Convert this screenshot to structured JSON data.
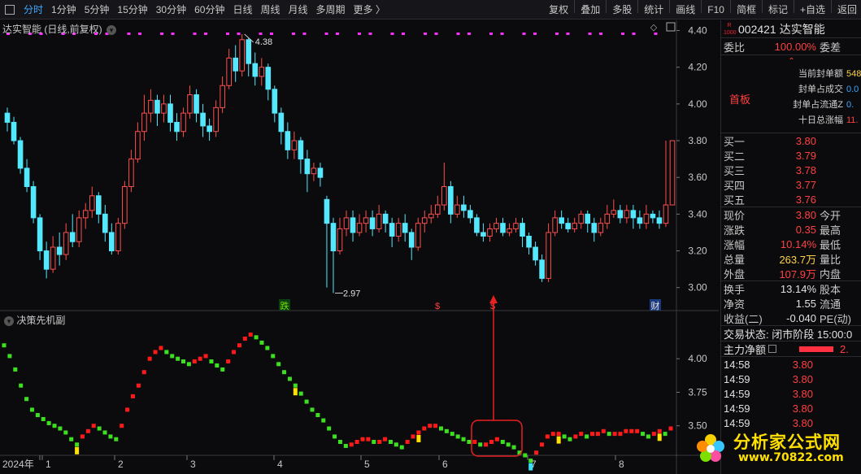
{
  "toolbar": {
    "items": [
      "分时",
      "1分钟",
      "5分钟",
      "15分钟",
      "30分钟",
      "60分钟",
      "日线",
      "周线",
      "月线",
      "多周期",
      "更多 〉"
    ],
    "right_items": [
      "复权",
      "叠加",
      "多股",
      "统计",
      "画线",
      "F10",
      "简框",
      "标记",
      "+自选",
      "返回"
    ]
  },
  "main_chart": {
    "title": "达实智能 (日线,前复权)",
    "y_ticks": [
      "4.40",
      "4.20",
      "4.00",
      "3.80",
      "3.60",
      "3.40",
      "3.20",
      "3.00"
    ],
    "high_label": "4.38",
    "low_label": "2.97",
    "markers": [
      "跌",
      "$",
      "$",
      "财"
    ]
  },
  "sub_chart": {
    "title": "决策先机副",
    "y_ticks": [
      "4.00",
      "3.75",
      "3.50"
    ]
  },
  "x_axis": {
    "labels": [
      "2024年",
      "1",
      "2",
      "3",
      "4",
      "5",
      "6",
      "7",
      "8"
    ]
  },
  "quote": {
    "code": "002421",
    "name": "达实智能",
    "badge_top": "R",
    "badge_bottom": "1000",
    "weibi_label": "委比",
    "weibi_value": "100.00%",
    "weicha_label": "委差",
    "seal": {
      "lines": [
        "当前封单额",
        "封单占成交",
        "封单占流通Z",
        "十日总涨幅"
      ],
      "values": [
        "548",
        "0.0",
        "0.",
        "11."
      ],
      "tag": "首板"
    },
    "bids": [
      {
        "label": "买一",
        "price": "3.80"
      },
      {
        "label": "买二",
        "price": "3.79"
      },
      {
        "label": "买三",
        "price": "3.78"
      },
      {
        "label": "买四",
        "price": "3.77"
      },
      {
        "label": "买五",
        "price": "3.76"
      }
    ],
    "stats": [
      {
        "label": "现价",
        "value": "3.80",
        "label2": "今开",
        "cls": "red"
      },
      {
        "label": "涨跌",
        "value": "0.35",
        "label2": "最高",
        "cls": "red"
      },
      {
        "label": "涨幅",
        "value": "10.14%",
        "label2": "最低",
        "cls": "red"
      },
      {
        "label": "总量",
        "value": "263.7万",
        "label2": "量比",
        "cls": "yellow"
      },
      {
        "label": "外盘",
        "value": "107.9万",
        "label2": "内盘",
        "cls": "red"
      }
    ],
    "stats2": [
      {
        "label": "换手",
        "value": "13.14%",
        "label2": "股本",
        "cls": "white"
      },
      {
        "label": "净资",
        "value": "1.55",
        "label2": "流通",
        "cls": "white"
      },
      {
        "label": "收益(二)",
        "value": "-0.040",
        "label2": "PE(动)",
        "cls": "white"
      }
    ],
    "trade_status": "交易状态: 闭市阶段 15:00:0",
    "main_flow_label": "主力净额",
    "main_flow_value": "2.",
    "ticks": [
      {
        "time": "14:58",
        "price": "3.80"
      },
      {
        "time": "14:59",
        "price": "3.80"
      },
      {
        "time": "14:59",
        "price": "3.80"
      },
      {
        "time": "14:59",
        "price": "3.80"
      },
      {
        "time": "14:59",
        "price": "3.80"
      }
    ]
  },
  "watermark": {
    "text": "分析家公式网",
    "url": "www.70822.com"
  },
  "chart_data": {
    "type": "candlestick",
    "title": "达实智能 (日线,前复权)",
    "ylim": [
      2.95,
      4.42
    ],
    "candles": [
      [
        3.95,
        3.9,
        3.98,
        3.85
      ],
      [
        3.9,
        3.8,
        3.93,
        3.78
      ],
      [
        3.8,
        3.65,
        3.82,
        3.62
      ],
      [
        3.65,
        3.55,
        3.7,
        3.52
      ],
      [
        3.55,
        3.38,
        3.58,
        3.35
      ],
      [
        3.38,
        3.2,
        3.4,
        3.15
      ],
      [
        3.2,
        3.1,
        3.25,
        3.05
      ],
      [
        3.1,
        3.22,
        3.28,
        3.08
      ],
      [
        3.22,
        3.18,
        3.3,
        3.12
      ],
      [
        3.18,
        3.3,
        3.35,
        3.15
      ],
      [
        3.3,
        3.25,
        3.4,
        3.22
      ],
      [
        3.25,
        3.38,
        3.42,
        3.22
      ],
      [
        3.38,
        3.42,
        3.46,
        3.32
      ],
      [
        3.42,
        3.5,
        3.55,
        3.38
      ],
      [
        3.5,
        3.4,
        3.52,
        3.35
      ],
      [
        3.4,
        3.3,
        3.45,
        3.25
      ],
      [
        3.3,
        3.2,
        3.35,
        3.18
      ],
      [
        3.2,
        3.35,
        3.38,
        3.18
      ],
      [
        3.35,
        3.55,
        3.58,
        3.32
      ],
      [
        3.55,
        3.7,
        3.75,
        3.52
      ],
      [
        3.7,
        3.85,
        3.9,
        3.68
      ],
      [
        3.85,
        3.95,
        4.05,
        3.8
      ],
      [
        3.95,
        4.02,
        4.08,
        3.9
      ],
      [
        4.02,
        3.95,
        4.05,
        3.88
      ],
      [
        3.95,
        4.0,
        4.05,
        3.9
      ],
      [
        4.0,
        3.9,
        4.05,
        3.85
      ],
      [
        3.9,
        3.85,
        3.95,
        3.8
      ],
      [
        3.85,
        3.95,
        3.98,
        3.82
      ],
      [
        3.95,
        4.05,
        4.1,
        3.92
      ],
      [
        4.05,
        3.95,
        4.08,
        3.9
      ],
      [
        3.95,
        3.88,
        4.0,
        3.82
      ],
      [
        3.88,
        3.85,
        3.92,
        3.8
      ],
      [
        3.85,
        3.98,
        4.02,
        3.82
      ],
      [
        3.98,
        4.1,
        4.15,
        3.95
      ],
      [
        4.1,
        4.25,
        4.3,
        4.08
      ],
      [
        4.25,
        4.18,
        4.32,
        4.12
      ],
      [
        4.18,
        4.35,
        4.38,
        4.15
      ],
      [
        4.35,
        4.22,
        4.36,
        4.15
      ],
      [
        4.22,
        4.15,
        4.28,
        4.1
      ],
      [
        4.15,
        4.2,
        4.25,
        4.1
      ],
      [
        4.2,
        4.08,
        4.22,
        4.02
      ],
      [
        4.08,
        3.95,
        4.1,
        3.9
      ],
      [
        3.95,
        3.85,
        3.98,
        3.78
      ],
      [
        3.85,
        3.75,
        3.9,
        3.7
      ],
      [
        3.75,
        3.8,
        3.85,
        3.7
      ],
      [
        3.8,
        3.7,
        3.82,
        3.62
      ],
      [
        3.7,
        3.62,
        3.75,
        3.52
      ],
      [
        3.62,
        3.65,
        3.68,
        3.58
      ],
      [
        3.65,
        3.6,
        3.68,
        3.55
      ],
      [
        3.48,
        3.35,
        3.5,
        3.0
      ],
      [
        3.35,
        3.2,
        3.38,
        2.97
      ],
      [
        3.2,
        3.32,
        3.38,
        3.18
      ],
      [
        3.32,
        3.38,
        3.42,
        3.28
      ],
      [
        3.38,
        3.3,
        3.42,
        3.25
      ],
      [
        3.3,
        3.35,
        3.4,
        3.28
      ],
      [
        3.35,
        3.38,
        3.42,
        3.3
      ],
      [
        3.38,
        3.32,
        3.42,
        3.28
      ],
      [
        3.32,
        3.4,
        3.45,
        3.3
      ],
      [
        3.4,
        3.35,
        3.42,
        3.3
      ],
      [
        3.35,
        3.28,
        3.38,
        3.22
      ],
      [
        3.28,
        3.35,
        3.38,
        3.25
      ],
      [
        3.35,
        3.3,
        3.4,
        3.25
      ],
      [
        3.3,
        3.22,
        3.32,
        3.15
      ],
      [
        3.22,
        3.35,
        3.38,
        3.2
      ],
      [
        3.35,
        3.38,
        3.42,
        3.3
      ],
      [
        3.38,
        3.4,
        3.45,
        3.35
      ],
      [
        3.4,
        3.45,
        3.5,
        3.38
      ],
      [
        3.45,
        3.55,
        3.68,
        3.42
      ],
      [
        3.55,
        3.4,
        3.58,
        3.35
      ],
      [
        3.4,
        3.45,
        3.5,
        3.38
      ],
      [
        3.45,
        3.42,
        3.5,
        3.38
      ],
      [
        3.42,
        3.38,
        3.45,
        3.35
      ],
      [
        3.38,
        3.3,
        3.4,
        3.28
      ],
      [
        3.3,
        3.28,
        3.35,
        3.25
      ],
      [
        3.28,
        3.32,
        3.35,
        3.25
      ],
      [
        3.32,
        3.35,
        3.38,
        3.3
      ],
      [
        3.35,
        3.3,
        3.38,
        3.28
      ],
      [
        3.3,
        3.32,
        3.35,
        3.28
      ],
      [
        3.32,
        3.35,
        3.38,
        3.3
      ],
      [
        3.35,
        3.28,
        3.38,
        3.22
      ],
      [
        3.28,
        3.22,
        3.3,
        3.18
      ],
      [
        3.22,
        3.15,
        3.25,
        3.12
      ],
      [
        3.15,
        3.05,
        3.18,
        3.03
      ],
      [
        3.05,
        3.3,
        3.35,
        3.03
      ],
      [
        3.3,
        3.38,
        3.42,
        3.28
      ],
      [
        3.38,
        3.35,
        3.42,
        3.32
      ],
      [
        3.35,
        3.32,
        3.38,
        3.3
      ],
      [
        3.32,
        3.35,
        3.38,
        3.3
      ],
      [
        3.35,
        3.4,
        3.42,
        3.32
      ],
      [
        3.4,
        3.35,
        3.42,
        3.3
      ],
      [
        3.35,
        3.3,
        3.38,
        3.25
      ],
      [
        3.3,
        3.35,
        3.38,
        3.28
      ],
      [
        3.35,
        3.4,
        3.45,
        3.32
      ],
      [
        3.4,
        3.42,
        3.48,
        3.38
      ],
      [
        3.42,
        3.38,
        3.45,
        3.35
      ],
      [
        3.38,
        3.42,
        3.45,
        3.35
      ],
      [
        3.42,
        3.38,
        3.45,
        3.32
      ],
      [
        3.38,
        3.35,
        3.42,
        3.32
      ],
      [
        3.35,
        3.4,
        3.45,
        3.32
      ],
      [
        3.4,
        3.38,
        3.42,
        3.35
      ],
      [
        3.38,
        3.35,
        3.42,
        3.32
      ],
      [
        3.35,
        3.45,
        3.8,
        3.33
      ],
      [
        3.45,
        3.8,
        3.8,
        3.45
      ]
    ],
    "oscillator": [
      4.1,
      4.02,
      3.92,
      3.8,
      3.7,
      3.62,
      3.58,
      3.55,
      3.52,
      3.5,
      3.48,
      3.45,
      3.4,
      3.36,
      3.42,
      3.46,
      3.5,
      3.48,
      3.45,
      3.42,
      3.4,
      3.5,
      3.62,
      3.72,
      3.8,
      3.9,
      4.0,
      4.05,
      4.08,
      4.05,
      4.02,
      4.0,
      3.98,
      3.96,
      3.98,
      4.0,
      4.02,
      3.98,
      3.95,
      3.92,
      3.98,
      4.05,
      4.1,
      4.15,
      4.18,
      4.16,
      4.12,
      4.08,
      4.02,
      3.96,
      3.9,
      3.85,
      3.8,
      3.74,
      3.68,
      3.62,
      3.58,
      3.54,
      3.48,
      3.42,
      3.38,
      3.35,
      3.36,
      3.38,
      3.4,
      3.4,
      3.38,
      3.38,
      3.4,
      3.38,
      3.36,
      3.34,
      3.38,
      3.42,
      3.45,
      3.48,
      3.5,
      3.5,
      3.48,
      3.46,
      3.44,
      3.42,
      3.4,
      3.38,
      3.38,
      3.36,
      3.36,
      3.38,
      3.4,
      3.38,
      3.36,
      3.34,
      3.3,
      3.28,
      3.24,
      3.3,
      3.36,
      3.42,
      3.44,
      3.44,
      3.42,
      3.4,
      3.42,
      3.44,
      3.42,
      3.44,
      3.44,
      3.46,
      3.44,
      3.44,
      3.44,
      3.46,
      3.46,
      3.46,
      3.44,
      3.42,
      3.44,
      3.46,
      3.44,
      3.48
    ],
    "sub_ylim": [
      3.28,
      4.25
    ]
  }
}
